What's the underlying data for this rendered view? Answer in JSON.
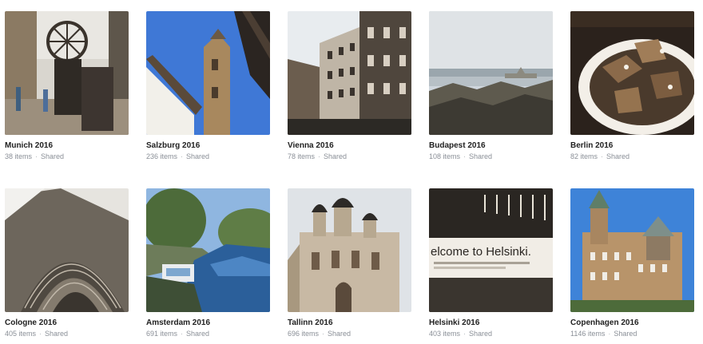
{
  "albums": [
    {
      "title": "Munich 2016",
      "count": "38 items",
      "sharing": "Shared"
    },
    {
      "title": "Salzburg 2016",
      "count": "236 items",
      "sharing": "Shared"
    },
    {
      "title": "Vienna 2016",
      "count": "78 items",
      "sharing": "Shared"
    },
    {
      "title": "Budapest 2016",
      "count": "108 items",
      "sharing": "Shared"
    },
    {
      "title": "Berlin 2016",
      "count": "82 items",
      "sharing": "Shared"
    },
    {
      "title": "Cologne 2016",
      "count": "405 items",
      "sharing": "Shared"
    },
    {
      "title": "Amsterdam 2016",
      "count": "691 items",
      "sharing": "Shared"
    },
    {
      "title": "Tallinn 2016",
      "count": "696 items",
      "sharing": "Shared"
    },
    {
      "title": "Helsinki 2016",
      "count": "403 items",
      "sharing": "Shared"
    },
    {
      "title": "Copenhagen 2016",
      "count": "1146 items",
      "sharing": "Shared"
    }
  ],
  "photo_text": {
    "helsinki_sign": "elcome to Helsinki."
  },
  "colors": {
    "title": "#212121",
    "meta": "#8a8f97"
  }
}
